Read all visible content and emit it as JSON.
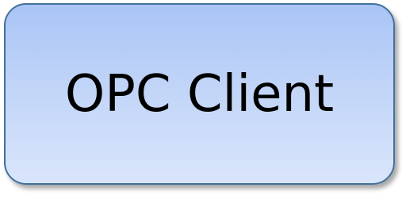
{
  "diagram": {
    "node": {
      "label": "OPC Client"
    },
    "colors": {
      "fill_top": "#a9c4f5",
      "fill_bottom": "#d9e5fb",
      "border": "#41719c",
      "text": "#000000"
    }
  }
}
